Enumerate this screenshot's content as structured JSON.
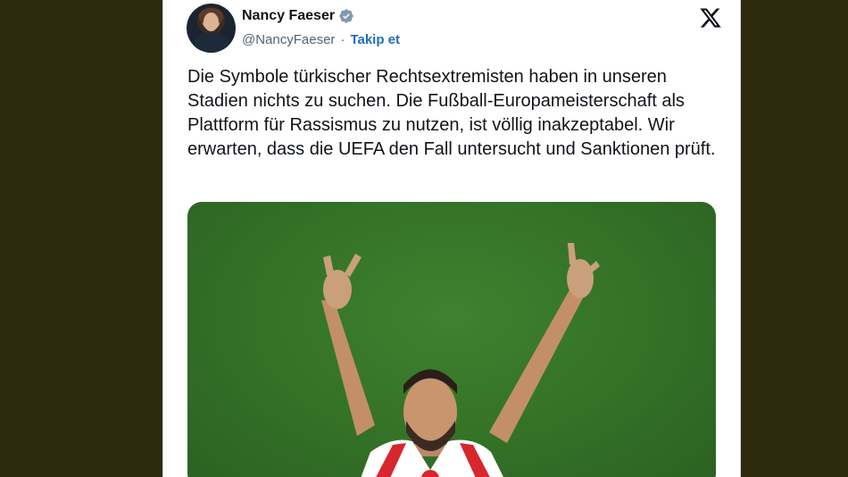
{
  "author": {
    "name": "Nancy Faeser",
    "handle": "@NancyFaeser",
    "separator": "·",
    "follow_label": "Takip et"
  },
  "icons": {
    "verified": "verified-badge-icon",
    "platform": "x-logo-icon"
  },
  "tweet": {
    "text": "Die Symbole türkischer Rechtsextremisten haben in unseren Stadien nichts zu suchen. Die Fußball-Europameisterschaft als Plattform für Rassismus zu nutzen, ist völlig inakzeptabel. Wir erwarten, dass die UEFA den Fall untersucht und Sanktionen prüft."
  },
  "colors": {
    "background": "#2e2a0e",
    "verified": "#829aab",
    "link": "#1d6fb8"
  }
}
